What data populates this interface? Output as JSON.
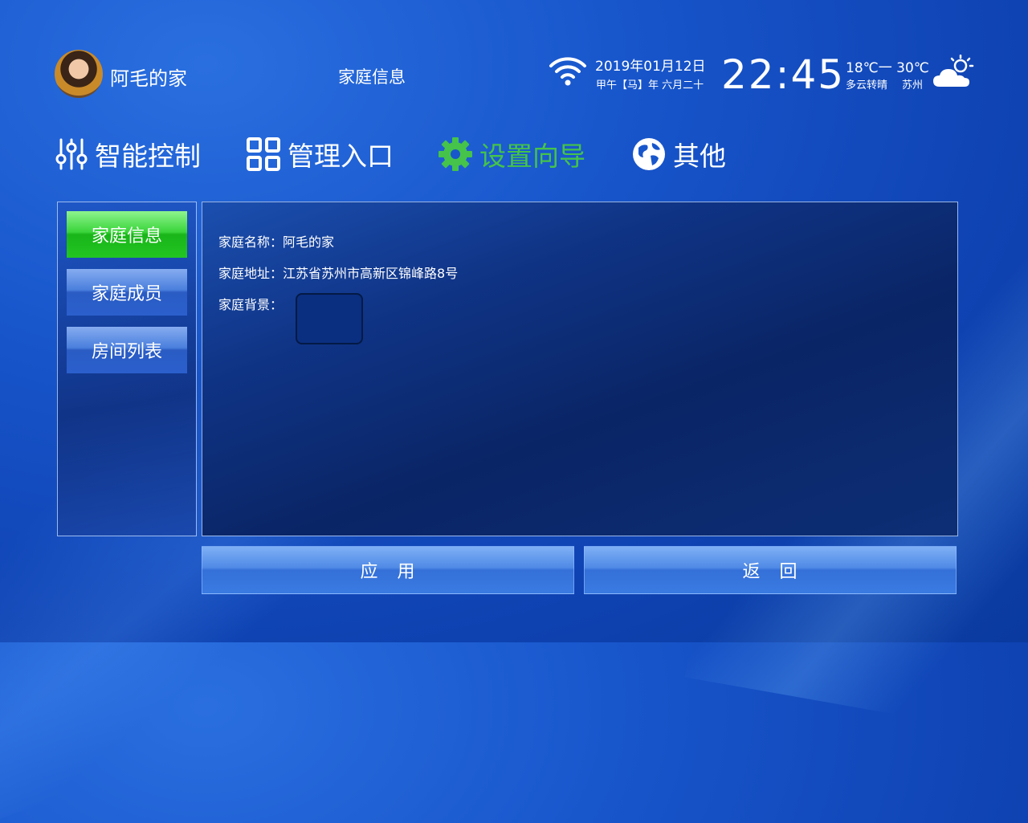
{
  "header": {
    "home_name": "阿毛的家",
    "page_title": "家庭信息",
    "date": "2019年01月12日",
    "lunar": "甲午【马】年 六月二十",
    "time": "22:45",
    "temperature": "18℃一 30℃",
    "weather": "多云转晴",
    "city": "苏州",
    "icons": [
      "avatar",
      "wifi-icon",
      "partly-cloudy-icon"
    ]
  },
  "nav": {
    "items": [
      {
        "label": "智能控制",
        "icon": "sliders-icon"
      },
      {
        "label": "管理入口",
        "icon": "grid-icon"
      },
      {
        "label": "设置向导",
        "icon": "gear-icon",
        "active": true
      },
      {
        "label": "其他",
        "icon": "globe-icon"
      }
    ],
    "active_color": "#45c34a"
  },
  "sidebar": {
    "items": [
      {
        "label": "家庭信息",
        "active": true
      },
      {
        "label": "家庭成员"
      },
      {
        "label": "房间列表"
      }
    ]
  },
  "form": {
    "name_label": "家庭名称：",
    "name_value": "阿毛的家",
    "address_label": "家庭地址：",
    "address_value": "江苏省苏州市高新区锦峰路8号",
    "background_label": "家庭背景："
  },
  "actions": {
    "apply": "应　用",
    "back": "返　回"
  },
  "colors": {
    "background": "#1856cc",
    "active_button": "#22c522",
    "normal_button": "#2b5fcc"
  }
}
